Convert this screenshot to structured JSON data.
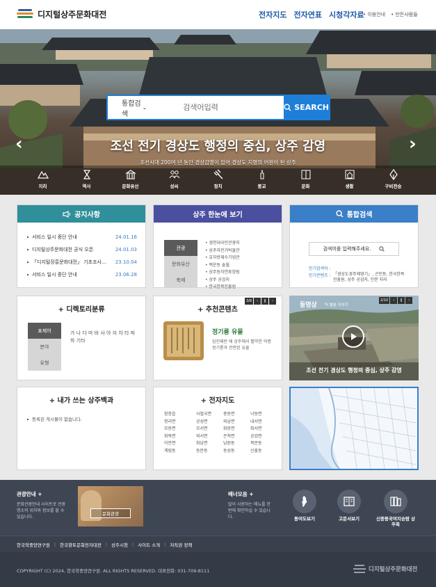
{
  "header": {
    "logo_text": "디지털상주문화대전",
    "nav": [
      "전자지도",
      "전자연표",
      "시청각자료"
    ],
    "util": [
      "이용안내",
      "만든사람들"
    ]
  },
  "hero": {
    "search_select": "통합검색",
    "search_placeholder": "검색어입력",
    "search_button": "SEARCH",
    "title": "조선 전기 경상도 행정의 중심, 상주 감영",
    "subtitle": "조선시대 200여 년 동안 경상감영이 있어 경상도 지명의 어원이 된 상주",
    "categories": [
      "지리",
      "역사",
      "문화유산",
      "성씨",
      "정치",
      "종교",
      "문화",
      "생활",
      "구비전승"
    ]
  },
  "notice": {
    "title": "공지사항",
    "items": [
      {
        "text": "서비스 일시 중단 안내",
        "date": "24.01.16"
      },
      {
        "text": "디지털상주문화대전 공식 오픈",
        "date": "24.01.03"
      },
      {
        "text": "「디지털장흥문화대전」 기초조사...",
        "date": "23.10.04"
      },
      {
        "text": "서비스 일시 중단 안내",
        "date": "23.06.28"
      }
    ]
  },
  "hanbune": {
    "title": "상주 한눈에 보기",
    "tabs": [
      "관광",
      "문화유산",
      "축제"
    ],
    "items": [
      "경천대국민관광지",
      "상주자전거박물관",
      "호자방재수기념관",
      "백운동 숲월",
      "상주동자연휴양림",
      "상주 공검지",
      "한국한복진흥원"
    ]
  },
  "integrated": {
    "title": "통합검색",
    "input": "검색어를 입력해주세요.",
    "label1": "인기검색어 :",
    "label2": "인기콘텐츠 :",
    "content": "「경상도경주제영기」, 곤인동, 한국한복진흥원, 상주 공검지, 인문 지리"
  },
  "directory": {
    "title": "+ 디렉토리분류",
    "tabs": [
      "표제어",
      "분야",
      "유형"
    ],
    "letters": "가 나 다 마 바 사 아 자 차 타 파 하 기타"
  },
  "recommend": {
    "title": "+ 추천콘텐츠",
    "pager": "3/8",
    "item_title": "정기룡 유물",
    "item_desc": "임진왜란 때 상주에서 활약한 의병 정기룡과 관련된 유물"
  },
  "video": {
    "label": "동영상",
    "sub": "틱 별뷴 이야기",
    "pager": "2/10",
    "caption": "조선 전기 경상도 행정의 중심, 상주 감영"
  },
  "baekgwa": {
    "title": "+ 내가 쓰는 상주백과",
    "empty": "등록된 게시물이 없습니다."
  },
  "emap": {
    "title": "+ 전자지도",
    "cols": [
      [
        "함창읍",
        "청리면",
        "모동면",
        "화북면",
        "이안면",
        "계림동"
      ],
      [
        "사벌국면",
        "공성면",
        "모서면",
        "외서면",
        "화남면",
        "동문동"
      ],
      [
        "중동면",
        "외남면",
        "화동면",
        "은척면",
        "남원동",
        "동성동"
      ],
      [
        "낙동면",
        "내서면",
        "화서면",
        "공검면",
        "북문동",
        "신흥동"
      ]
    ]
  },
  "footer": {
    "tour_title": "관광안내",
    "tour_desc": "문화관광안내 사이트로 관광명소의 위치와 정보를 볼 수 있습니다.",
    "tour_btn": "문화관광",
    "banner_title": "배너모음",
    "banner_desc": "많이 사용하는 메뉴를 한번에 확인하실 수 있습니다.",
    "icons": [
      "동여도보기",
      "고문서보기",
      "신증동국여지승람 상주목"
    ],
    "links": [
      "한국학중앙연구원",
      "한국향토문화전자대전",
      "상주시청",
      "사이트 소개",
      "저작권 정책"
    ],
    "copyright": "COPYRIGHT (C) 2024, 한국학중앙연구원. ALL RIGHTS RESERVED. 대표전화: 031-709-8111",
    "logo": "디지털상주문화대전"
  }
}
